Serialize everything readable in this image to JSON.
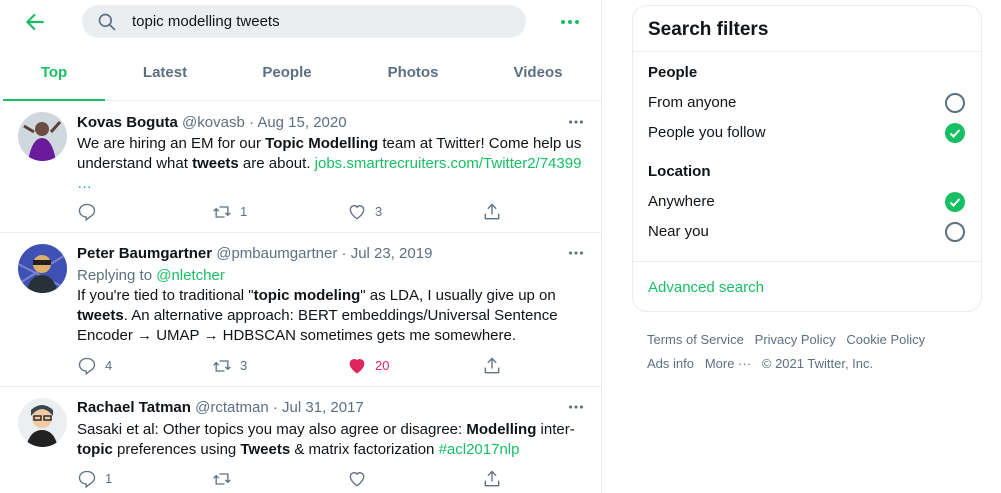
{
  "search": {
    "query": "topic modelling tweets"
  },
  "tabs": [
    "Top",
    "Latest",
    "People",
    "Photos",
    "Videos"
  ],
  "accent_color": "#17bf63",
  "tweets": [
    {
      "name": "Kovas Boguta",
      "handle": "@kovasb",
      "date": "Aug 15, 2020",
      "body": [
        {
          "t": "We are hiring an EM for our "
        },
        {
          "t": "Topic Modelling",
          "b": true
        },
        {
          "t": " team at Twitter! Come help us understand what "
        },
        {
          "t": "tweets",
          "b": true
        },
        {
          "t": " are about.  "
        },
        {
          "t": "jobs.smartrecruiters.com/Twitter2/74399",
          "link": true
        },
        {
          "t": " …",
          "link": true
        }
      ],
      "replies": "",
      "retweets": "1",
      "likes": "3",
      "liked": false
    },
    {
      "name": "Peter Baumgartner",
      "handle": "@pmbaumgartner",
      "date": "Jul 23, 2019",
      "replying_label": "Replying to",
      "replying_handle": "@nletcher",
      "body": [
        {
          "t": "If you're tied to traditional \""
        },
        {
          "t": "topic modeling",
          "b": true
        },
        {
          "t": "\" as LDA, I usually give up on "
        },
        {
          "t": "tweets",
          "b": true
        },
        {
          "t": ". An alternative approach: BERT embeddings/Universal Sentence Encoder → UMAP → HDBSCAN sometimes gets me somewhere."
        }
      ],
      "replies": "4",
      "retweets": "3",
      "likes": "20",
      "liked": true
    },
    {
      "name": "Rachael Tatman",
      "handle": "@rctatman",
      "date": "Jul 31, 2017",
      "body": [
        {
          "t": "Sasaki et al: Other topics you may also agree or disagree: "
        },
        {
          "t": "Modelling",
          "b": true
        },
        {
          "t": " inter-"
        },
        {
          "t": "topic",
          "b": true
        },
        {
          "t": " preferences using "
        },
        {
          "t": "Tweets",
          "b": true
        },
        {
          "t": " & matrix factorization "
        },
        {
          "t": "#acl2017nlp",
          "link": true
        }
      ],
      "replies": "1",
      "retweets": "",
      "likes": "",
      "liked": false
    }
  ],
  "filters": {
    "title": "Search filters",
    "people_label": "People",
    "people_options": [
      {
        "label": "From anyone",
        "selected": false
      },
      {
        "label": "People you follow",
        "selected": true
      }
    ],
    "location_label": "Location",
    "location_options": [
      {
        "label": "Anywhere",
        "selected": true
      },
      {
        "label": "Near you",
        "selected": false
      }
    ],
    "advanced": "Advanced search"
  },
  "footer": {
    "terms": "Terms of Service",
    "privacy": "Privacy Policy",
    "cookie": "Cookie Policy",
    "ads": "Ads info",
    "more": "More ···",
    "copyright": "© 2021 Twitter, Inc."
  }
}
